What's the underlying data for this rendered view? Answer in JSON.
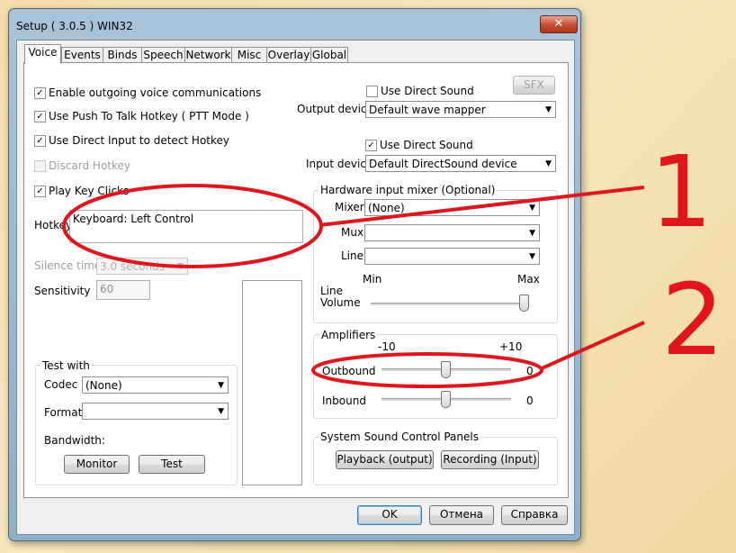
{
  "window": {
    "title": "Setup ( 3.0.5 ) WIN32",
    "close_symbol": "✕"
  },
  "tabs": [
    "Voice",
    "Events",
    "Binds",
    "Speech",
    "Network",
    "Misc",
    "Overlay",
    "Global"
  ],
  "active_tab": "Voice",
  "left": {
    "enable_voice": "Enable outgoing voice communications",
    "push_to_talk": "Use Push To Talk Hotkey ( PTT Mode )",
    "direct_input": "Use Direct Input to detect Hotkey",
    "discard_hotkey": "Discard Hotkey",
    "play_key_clicks": "Play Key Clicks",
    "hotkey_label": "Hotkey",
    "hotkey_value": "Keyboard: Left Control",
    "silence_time_label": "Silence time",
    "silence_time_value": "3.0 seconds",
    "sensitivity_label": "Sensitivity",
    "sensitivity_value": "60"
  },
  "test_with": {
    "title": "Test with",
    "codec_label": "Codec",
    "codec_value": "(None)",
    "format_label": "Format",
    "format_value": "",
    "bandwidth_label": "Bandwidth:",
    "monitor_button": "Monitor",
    "test_button": "Test"
  },
  "output": {
    "use_direct_sound": "Use Direct Sound",
    "sfx_button": "SFX",
    "device_label": "Output device",
    "device_value": "Default wave mapper"
  },
  "input": {
    "use_direct_sound": "Use Direct Sound",
    "device_label": "Input device",
    "device_value": "Default DirectSound device"
  },
  "mixer": {
    "title": "Hardware input mixer (Optional)",
    "mixer_label": "Mixer",
    "mixer_value": "(None)",
    "mux_label": "Mux",
    "line_label": "Line",
    "min_label": "Min",
    "max_label": "Max",
    "line_volume_label": "Line Volume",
    "line_volume_level": 1.0
  },
  "amplifiers": {
    "title": "Amplifiers",
    "min_label": "-10",
    "max_label": "+10",
    "outbound_label": "Outbound",
    "outbound_value": "0",
    "inbound_label": "Inbound",
    "inbound_value": "0"
  },
  "sound_panels": {
    "title": "System Sound Control Panels",
    "playback_button": "Playback (output)",
    "recording_button": "Recording (Input)"
  },
  "footer": {
    "ok": "OK",
    "cancel": "Отмена",
    "help": "Справка"
  },
  "annotations": {
    "one": "1",
    "two": "2",
    "color": "#e0161b"
  }
}
